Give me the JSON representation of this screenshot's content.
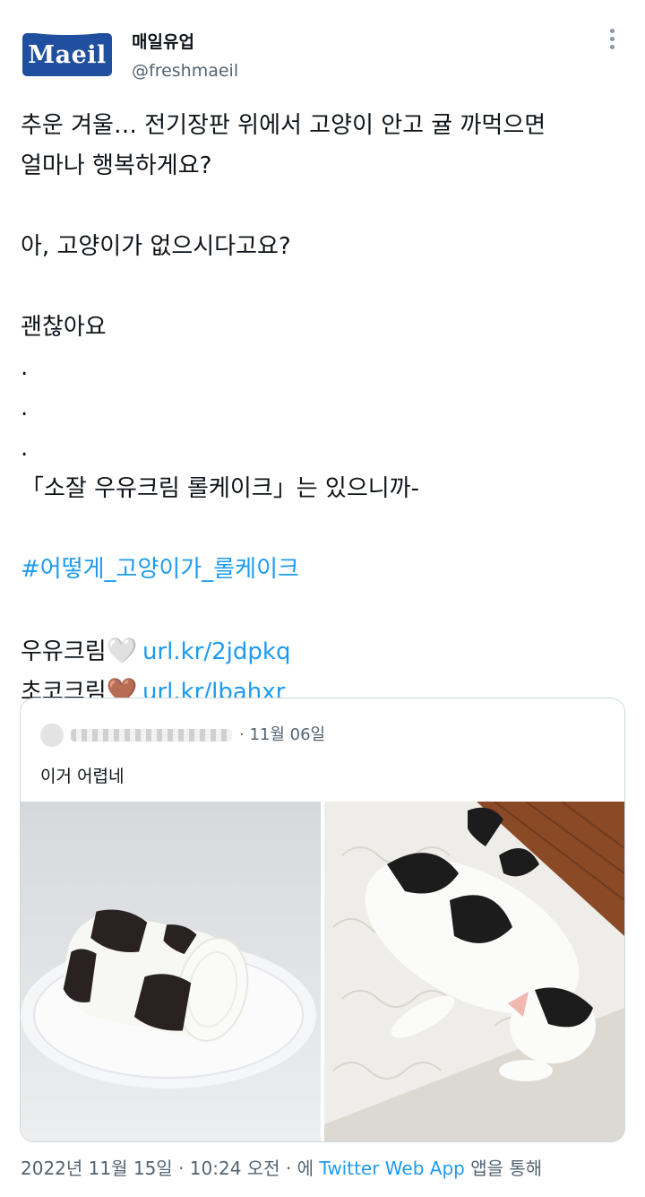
{
  "author": {
    "logo_text": "Maeil",
    "display_name": "매일유업",
    "handle": "@freshmaeil"
  },
  "tweet": {
    "lines": [
      "추운 겨울… 전기장판 위에서 고양이 안고 귤 까먹으면",
      "얼마나 행복하게요?",
      "",
      "아, 고양이가 없으시다고요?",
      "",
      "괜찮아요",
      ".",
      ".",
      ".",
      "「소잘 우유크림 롤케이크」는 있으니까-",
      ""
    ],
    "hashtag": "#어떻게_고양이가_롤케이크",
    "links": [
      {
        "label": "우유크림",
        "heart": "🤍",
        "url": "url.kr/2jdpkq"
      },
      {
        "label": "초코크림",
        "heart": "🤎",
        "url": "url.kr/lbahxr"
      }
    ]
  },
  "quote": {
    "date": "· 11월 06일",
    "text": "이거 어렵네",
    "images": [
      "cow-pattern-roll-cake-image",
      "black-white-cat-on-mattress-image"
    ]
  },
  "footer": {
    "timestamp": "2022년 11월 15일 · 10:24 오전 · 에",
    "source": "Twitter Web App",
    "suffix": "앱을 통해"
  },
  "colors": {
    "link": "#1d9bf0",
    "secondary_text": "#536471",
    "brand_blue": "#1f4f9e"
  }
}
